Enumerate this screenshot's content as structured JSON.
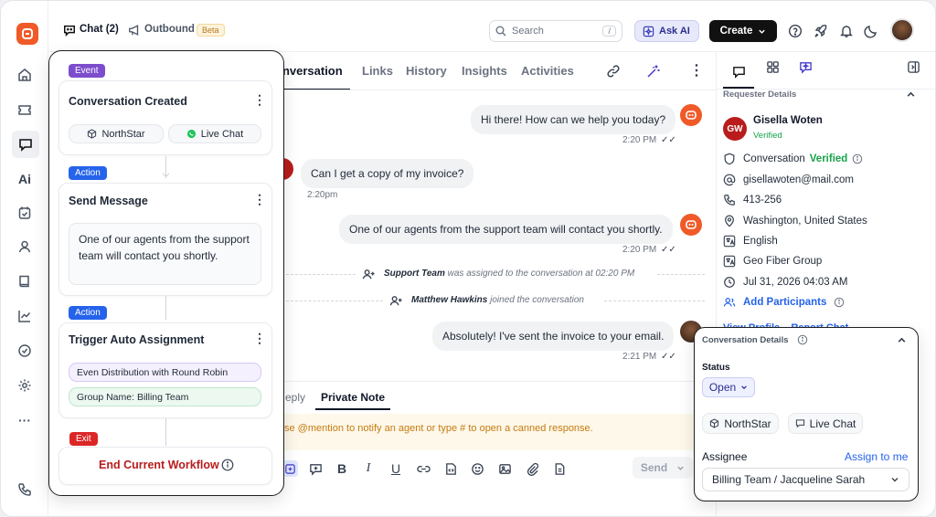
{
  "topbar": {
    "chat_label": "Chat (2)",
    "outbound_label": "Outbound",
    "beta_badge": "Beta",
    "search_placeholder": "Search",
    "search_shortcut": "/",
    "ask_ai_label": "Ask AI",
    "create_label": "Create"
  },
  "rail": {
    "items": [
      "home-icon",
      "ticket-icon",
      "chat-icon",
      "ai-icon",
      "calendar-check-icon",
      "user-icon",
      "book-icon",
      "chart-icon",
      "check-circle-icon",
      "settings-icon",
      "more-icon",
      "phone-icon"
    ],
    "ai_text": "Ai",
    "more_text": "···"
  },
  "conversation": {
    "tabs": [
      "Conversation",
      "Links",
      "History",
      "Insights",
      "Activities"
    ],
    "active_tab_visible_text": "onversation",
    "messages": [
      {
        "text": "Hi there! How can we help you today?",
        "time": "2:20 PM",
        "side": "right"
      },
      {
        "text": "Can I get a copy of my invoice?",
        "time": "2:20pm",
        "side": "left"
      },
      {
        "text": "One of our agents from the support team will contact you shortly.",
        "time": "2:20 PM",
        "side": "right"
      },
      {
        "text": "Absolutely! I've sent the invoice to your email.",
        "time": "2:21 PM",
        "side": "right"
      }
    ],
    "system_events": [
      {
        "actor": "Support Team",
        "text": "was assigned to the conversation at 02:20 PM"
      },
      {
        "actor": "Matthew Hawkins",
        "text": "joined the conversation"
      }
    ],
    "ticks": "✓✓"
  },
  "composer": {
    "tab_reply": "Reply",
    "tab_reply_visible": "eply",
    "tab_note": "Private Note",
    "note_placeholder": "se @mention to notify an agent or type # to open a canned response.",
    "send_label": "Send",
    "hidden_hint": "Send an image"
  },
  "requester": {
    "section_title": "Requester Details",
    "initials": "GW",
    "name": "Gisella Woten",
    "verified": "Verified",
    "conversation_label": "Conversation",
    "conversation_status": "Verified",
    "email": "gisellawoten@mail.com",
    "phone": "413-256",
    "location": "Washington, United States",
    "language": "English",
    "company": "Geo Fiber Group",
    "datetime": "Jul 31, 2026 04:03 AM",
    "add_participants": "Add Participants",
    "more_links": "View Profile    Report Chat"
  },
  "workflow": {
    "steps": [
      {
        "tag": "Event",
        "tag_color": "#7c4dcc",
        "title": "Conversation Created",
        "chips": [
          "NorthStar",
          "Live Chat"
        ]
      },
      {
        "tag": "Action",
        "tag_color": "#2563eb",
        "title": "Send Message",
        "message": "One of our agents from the support team will contact you shortly."
      },
      {
        "tag": "Action",
        "tag_color": "#2563eb",
        "title": "Trigger Auto Assignment",
        "rules": [
          "Even Distribution with Round Robin",
          "Group Name: Billing Team"
        ]
      },
      {
        "tag": "Exit",
        "tag_color": "#dc2626",
        "title": "End Current Workflow"
      }
    ]
  },
  "details": {
    "title": "Conversation Details",
    "status_label": "Status",
    "status_value": "Open",
    "channel_chips": [
      "NorthStar",
      "Live Chat"
    ],
    "assignee_label": "Assignee",
    "assign_to_me": "Assign to me",
    "assignee_value": "Billing Team / Jacqueline Sarah"
  },
  "colors": {
    "brand": "#f05a28",
    "accent_link": "#2563eb",
    "verified_green": "#16a34a",
    "event_purple": "#7c4dcc",
    "action_blue": "#2563eb",
    "exit_red": "#dc2626"
  }
}
